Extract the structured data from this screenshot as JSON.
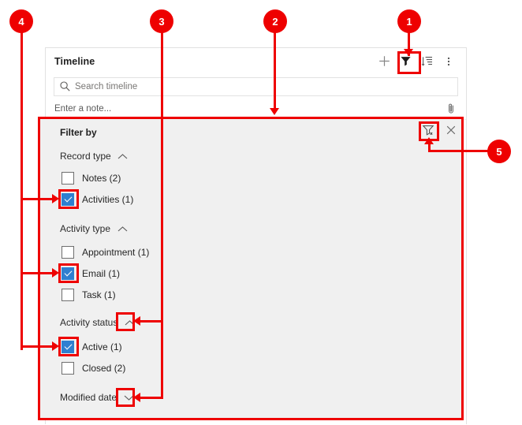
{
  "timeline": {
    "title": "Timeline",
    "actions": [
      {
        "name": "add-icon",
        "label": "Add",
        "glyph": "plus"
      },
      {
        "name": "filter-icon",
        "label": "Filter",
        "glyph": "funnel"
      },
      {
        "name": "sort-icon",
        "label": "Sort",
        "glyph": "sort-list"
      },
      {
        "name": "more-commands-icon",
        "label": "More commands",
        "glyph": "ellipsis-vertical"
      }
    ],
    "search": {
      "placeholder": "Search timeline",
      "value": "",
      "icon": "search-icon"
    },
    "note": {
      "placeholder": "Enter a note...",
      "attach_icon": "paperclip-icon"
    }
  },
  "filter_panel": {
    "heading": "Filter by",
    "clear_filter_label": "Clear filters",
    "close_label": "Close",
    "clear_filter_icon": "clear-filter-icon",
    "close_icon": "close-icon",
    "groups": [
      {
        "name": "record-type",
        "label": "Record type",
        "expanded": true,
        "chevron": "chevron-up-icon",
        "options": [
          {
            "label": "Notes (2)",
            "checked": false
          },
          {
            "label": "Activities (1)",
            "checked": true
          }
        ]
      },
      {
        "name": "activity-type",
        "label": "Activity type",
        "expanded": true,
        "chevron": "chevron-up-icon",
        "options": [
          {
            "label": "Appointment (1)",
            "checked": false
          },
          {
            "label": "Email (1)",
            "checked": true
          },
          {
            "label": "Task (1)",
            "checked": false
          }
        ]
      },
      {
        "name": "activity-status",
        "label": "Activity status",
        "expanded": true,
        "chevron": "chevron-up-icon",
        "options": [
          {
            "label": "Active (1)",
            "checked": true
          },
          {
            "label": "Closed (2)",
            "checked": false
          }
        ]
      },
      {
        "name": "modified-date",
        "label": "Modified date",
        "expanded": false,
        "chevron": "chevron-down-icon",
        "options": []
      }
    ]
  },
  "callouts": [
    {
      "number": "1",
      "target": "timeline-filter-toolbar-button"
    },
    {
      "number": "2",
      "target": "filter-panel"
    },
    {
      "number": "3",
      "target": "group-expand-collapse-chevrons"
    },
    {
      "number": "4",
      "target": "selected-filter-checkboxes"
    },
    {
      "number": "5",
      "target": "clear-filter-button"
    }
  ],
  "colors": {
    "annotation": "#ee0000",
    "checkbox_checked": "#2f7fd0",
    "panel_background": "#f0f0f0"
  }
}
